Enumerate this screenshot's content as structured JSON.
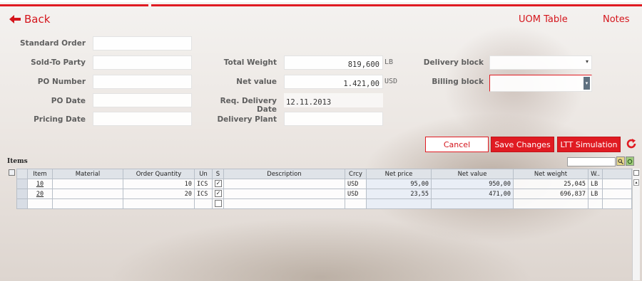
{
  "nav": {
    "back_label": "Back",
    "uom_table_label": "UOM Table",
    "notes_label": "Notes"
  },
  "colors": {
    "accent": "#e01b22",
    "header_bg": "#dfe3e8"
  },
  "form": {
    "standard_order_label": "Standard Order",
    "sold_to_party_label": "Sold-To Party",
    "po_number_label": "PO Number",
    "po_date_label": "PO Date",
    "pricing_date_label": "Pricing Date",
    "total_weight_label": "Total Weight",
    "total_weight_value": "819,600",
    "total_weight_unit": "LB",
    "net_value_label": "Net value",
    "net_value_value": "1.421,00",
    "net_value_unit": "USD",
    "req_delivery_date_label": "Req. Delivery Date",
    "req_delivery_date_value": "12.11.2013",
    "delivery_plant_label": "Delivery Plant",
    "delivery_block_label": "Delivery block",
    "billing_block_label": "Billing block"
  },
  "actions": {
    "cancel": "Cancel",
    "save_changes": "Save Changes",
    "ltt_simulation": "LTT Simulation"
  },
  "items": {
    "title": "Items",
    "columns": [
      "Item",
      "Material",
      "Order Quantity",
      "Un",
      "S",
      "Description",
      "Crcy",
      "Net price",
      "Net value",
      "Net weight",
      "W.."
    ],
    "rows": [
      {
        "item": "10",
        "material": "",
        "qty": "10",
        "un": "ICS",
        "s": "✓",
        "desc": "",
        "crcy": "USD",
        "net_price": "95,00",
        "net_value": "950,00",
        "net_weight": "25,045",
        "w": "LB"
      },
      {
        "item": "20",
        "material": "",
        "qty": "20",
        "un": "ICS",
        "s": "✓",
        "desc": "",
        "crcy": "USD",
        "net_price": "23,55",
        "net_value": "471,00",
        "net_weight": "696,837",
        "w": "LB"
      },
      {
        "item": "",
        "material": "",
        "qty": "",
        "un": "",
        "s": "",
        "desc": "",
        "crcy": "",
        "net_price": "",
        "net_value": "",
        "net_weight": "",
        "w": ""
      }
    ]
  }
}
